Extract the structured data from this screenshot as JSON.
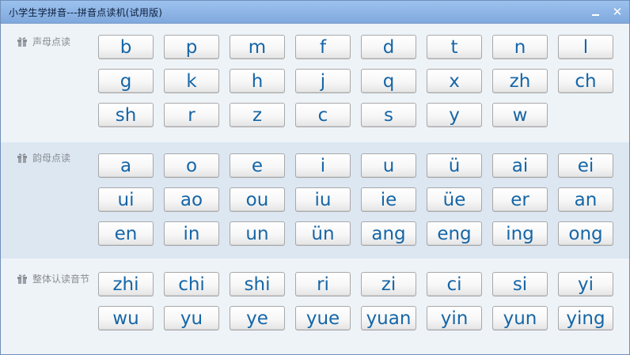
{
  "window": {
    "title": "小学生学拼音---拼音点读机(试用版)",
    "minimize_label": "",
    "close_label": "✕"
  },
  "sections": {
    "initials": {
      "label": "声母点读",
      "keys": [
        "b",
        "p",
        "m",
        "f",
        "d",
        "t",
        "n",
        "l",
        "g",
        "k",
        "h",
        "j",
        "q",
        "x",
        "zh",
        "ch",
        "sh",
        "r",
        "z",
        "c",
        "s",
        "y",
        "w"
      ]
    },
    "finals": {
      "label": "韵母点读",
      "keys": [
        "a",
        "o",
        "e",
        "i",
        "u",
        "ü",
        "ai",
        "ei",
        "ui",
        "ao",
        "ou",
        "iu",
        "ie",
        "üe",
        "er",
        "an",
        "en",
        "in",
        "un",
        "ün",
        "ang",
        "eng",
        "ing",
        "ong"
      ]
    },
    "whole": {
      "label": "整体认读音节",
      "keys": [
        "zhi",
        "chi",
        "shi",
        "ri",
        "zi",
        "ci",
        "si",
        "yi",
        "wu",
        "yu",
        "ye",
        "yue",
        "yuan",
        "yin",
        "yun",
        "ying"
      ]
    }
  }
}
